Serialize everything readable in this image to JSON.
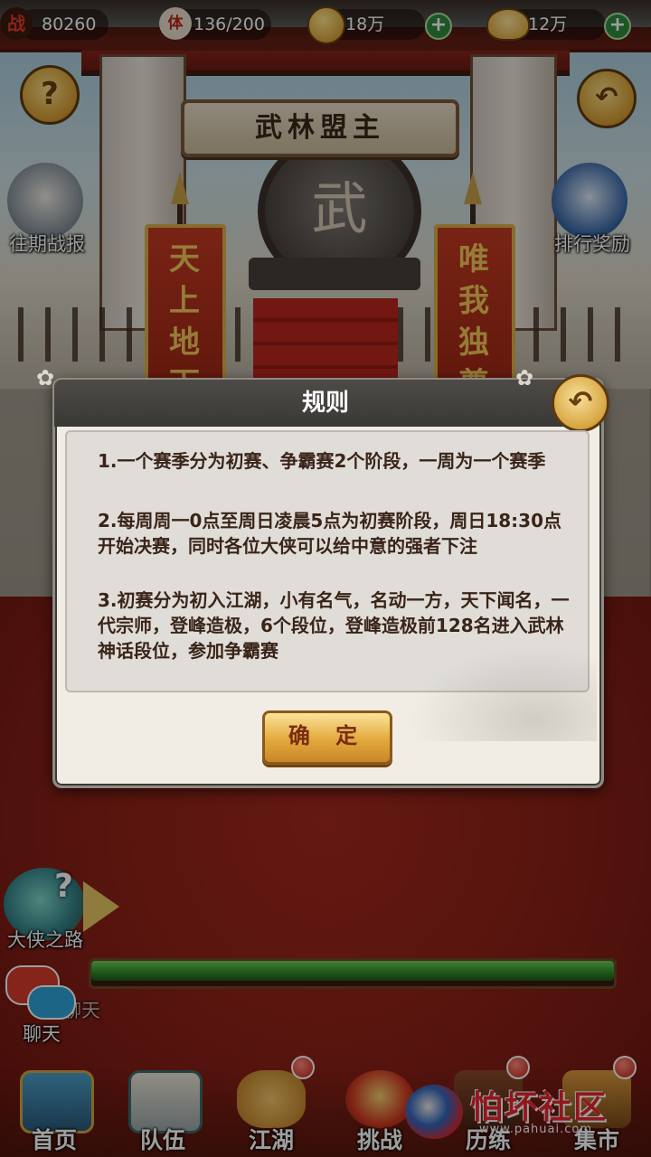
{
  "status_bar": {
    "power_icon": "战",
    "power_value": "80260",
    "stamina_icon": "体",
    "stamina_value": "136/200",
    "coins_value": "18万",
    "ingots_value": "12万",
    "plus_symbol": "+"
  },
  "scene": {
    "plaque_title": "武林盟主",
    "drum_char": "武",
    "left_banner": "天上地下",
    "right_banner": "唯我独尊"
  },
  "side_buttons": {
    "help_symbol": "?",
    "back_symbol": "↶",
    "past_reports_label": "往期战报",
    "rank_rewards_label": "排行奖励",
    "hero_road_label": "大侠之路",
    "chat_label": "聊天",
    "chat_bg_label": "聊天"
  },
  "dialog": {
    "title": "规则",
    "rules": [
      "1.一个赛季分为初赛、争霸赛2个阶段，一周为一个赛季",
      "2.每周周一0点至周日凌晨5点为初赛阶段，周日18:30点开始决赛，同时各位大侠可以给中意的强者下注",
      "3.初赛分为初入江湖，小有名气，名动一方，天下闻名，一代宗师，登峰造极，6个段位，登峰造极前128名进入武林神话段位，参加争霸赛"
    ],
    "confirm_label": "确 定",
    "back_symbol": "↶"
  },
  "progress": {
    "fraction": 1.0
  },
  "bottom_nav": {
    "items": [
      {
        "label": "首页"
      },
      {
        "label": "队伍"
      },
      {
        "label": "江湖"
      },
      {
        "label": "挑战"
      },
      {
        "label": "历练"
      },
      {
        "label": "集市"
      }
    ]
  },
  "watermark": {
    "text": "怕坏社区",
    "url": "www.pahuai.com"
  },
  "colors": {
    "accent_gold": "#e2a93c",
    "dialog_bg": "#f1ede5",
    "progress_green": "#2f8c2a",
    "alert_red": "#c3241a"
  }
}
